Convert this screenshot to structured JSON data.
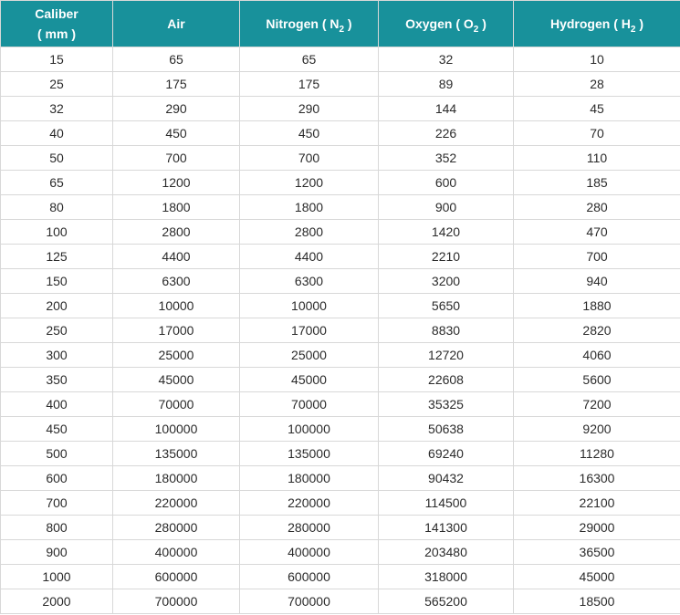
{
  "table": {
    "headers": {
      "caliber_line1": "Caliber",
      "caliber_line2": "( mm )",
      "air": "Air",
      "nitrogen_prefix": "Nitrogen ( N",
      "nitrogen_sub": "2",
      "nitrogen_suffix": " )",
      "oxygen_prefix": "Oxygen ( O",
      "oxygen_sub": "2",
      "oxygen_suffix": " )",
      "hydrogen_prefix": "Hydrogen ( H",
      "hydrogen_sub": "2",
      "hydrogen_suffix": " )"
    },
    "rows": [
      [
        "15",
        "65",
        "65",
        "32",
        "10"
      ],
      [
        "25",
        "175",
        "175",
        "89",
        "28"
      ],
      [
        "32",
        "290",
        "290",
        "144",
        "45"
      ],
      [
        "40",
        "450",
        "450",
        "226",
        "70"
      ],
      [
        "50",
        "700",
        "700",
        "352",
        "110"
      ],
      [
        "65",
        "1200",
        "1200",
        "600",
        "185"
      ],
      [
        "80",
        "1800",
        "1800",
        "900",
        "280"
      ],
      [
        "100",
        "2800",
        "2800",
        "1420",
        "470"
      ],
      [
        "125",
        "4400",
        "4400",
        "2210",
        "700"
      ],
      [
        "150",
        "6300",
        "6300",
        "3200",
        "940"
      ],
      [
        "200",
        "10000",
        "10000",
        "5650",
        "1880"
      ],
      [
        "250",
        "17000",
        "17000",
        "8830",
        "2820"
      ],
      [
        "300",
        "25000",
        "25000",
        "12720",
        "4060"
      ],
      [
        "350",
        "45000",
        "45000",
        "22608",
        "5600"
      ],
      [
        "400",
        "70000",
        "70000",
        "35325",
        "7200"
      ],
      [
        "450",
        "100000",
        "100000",
        "50638",
        "9200"
      ],
      [
        "500",
        "135000",
        "135000",
        "69240",
        "11280"
      ],
      [
        "600",
        "180000",
        "180000",
        "90432",
        "16300"
      ],
      [
        "700",
        "220000",
        "220000",
        "114500",
        "22100"
      ],
      [
        "800",
        "280000",
        "280000",
        "141300",
        "29000"
      ],
      [
        "900",
        "400000",
        "400000",
        "203480",
        "36500"
      ],
      [
        "1000",
        "600000",
        "600000",
        "318000",
        "45000"
      ],
      [
        "2000",
        "700000",
        "700000",
        "565200",
        "18500"
      ]
    ]
  },
  "colors": {
    "header_bg": "#18919b",
    "header_text": "#ffffff",
    "border": "#d8d8d8",
    "cell_text": "#2b2b2b"
  }
}
